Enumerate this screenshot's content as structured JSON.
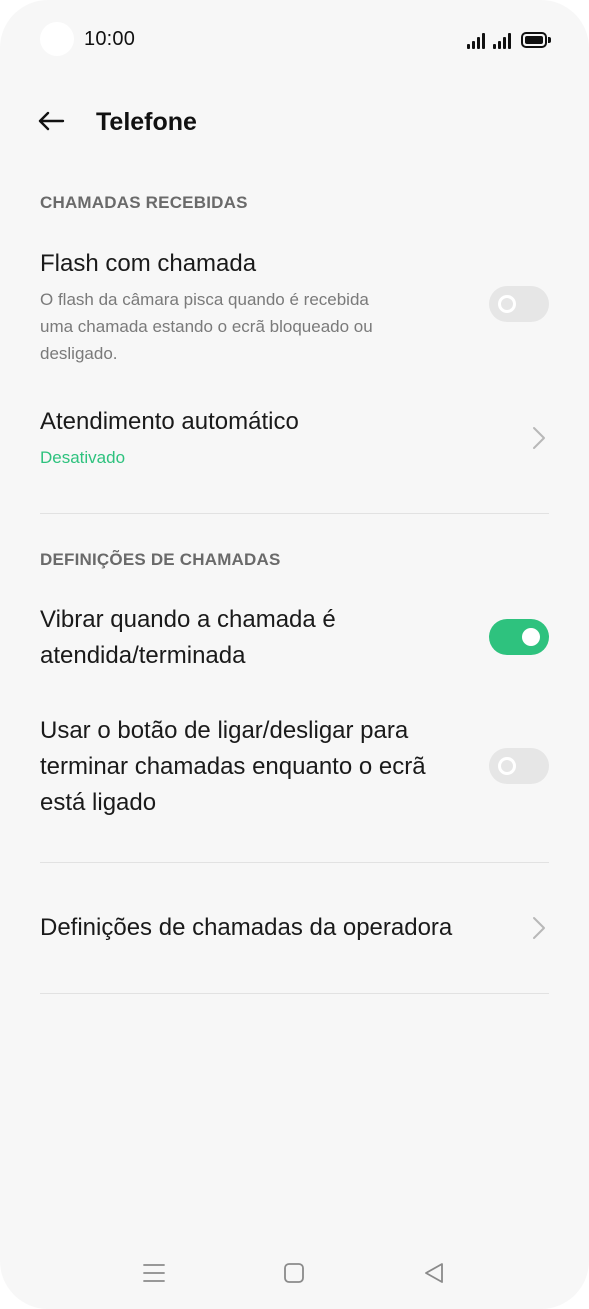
{
  "status_bar": {
    "time": "10:00",
    "icons": [
      "signal-icon",
      "signal-icon",
      "battery-icon"
    ]
  },
  "header": {
    "title": "Telefone",
    "back_icon": "arrow-left-icon"
  },
  "sections": [
    {
      "label": "CHAMADAS RECEBIDAS",
      "items": [
        {
          "title": "Flash com chamada",
          "subtitle_lines": [
            "O flash da câmara pisca quando é recebida",
            "uma chamada estando o ecrã bloqueado ou",
            "desligado."
          ],
          "control": "toggle",
          "enabled": false
        },
        {
          "title": "Atendimento automático",
          "status": "Desativado",
          "control": "chevron"
        }
      ]
    },
    {
      "label": "DEFINIÇÕES DE CHAMADAS",
      "items": [
        {
          "title_lines": [
            "Vibrar quando a chamada é",
            "atendida/terminada"
          ],
          "control": "toggle",
          "enabled": true
        },
        {
          "title_lines": [
            "Usar o botão de ligar/desligar para",
            "terminar chamadas enquanto o ecrã",
            "está ligado"
          ],
          "control": "toggle",
          "enabled": false
        }
      ]
    },
    {
      "items": [
        {
          "title": "Definições de chamadas da operadora",
          "control": "chevron"
        }
      ]
    }
  ],
  "colors": {
    "accent": "#2ec27e",
    "background": "#f7f7f7",
    "toggle_off": "#e6e6e6"
  },
  "nav_bar": {
    "icons": [
      "menu-icon",
      "home-icon",
      "back-triangle-icon"
    ]
  }
}
